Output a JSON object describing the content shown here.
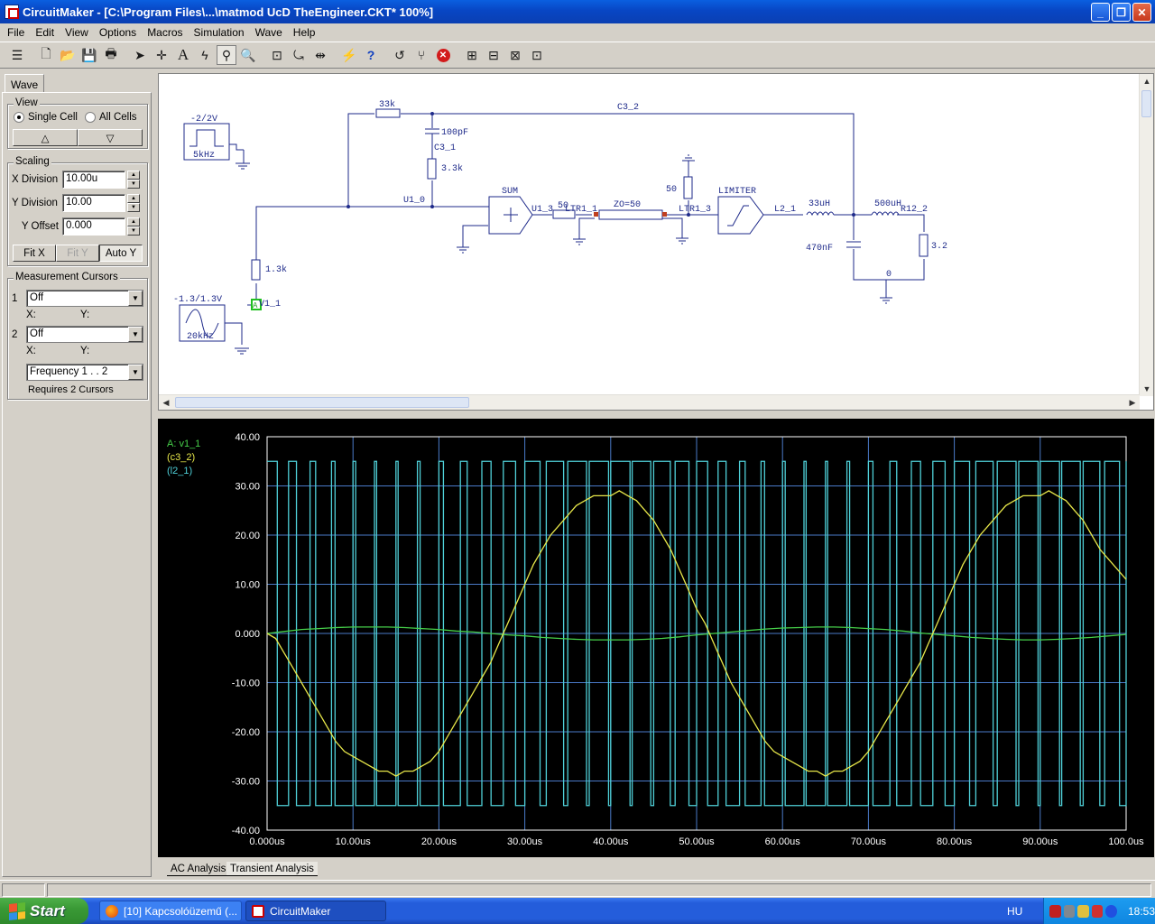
{
  "window": {
    "title": "CircuitMaker - [C:\\Program Files\\...\\matmod UcD TheEngineer.CKT* 100%]",
    "minimize_label": "_",
    "maximize_label": "❐",
    "close_label": "✕"
  },
  "menu": [
    "File",
    "Edit",
    "View",
    "Options",
    "Macros",
    "Simulation",
    "Wave",
    "Help"
  ],
  "panel": {
    "tab_label": "Wave",
    "view": {
      "title": "View",
      "single_cell": "Single Cell",
      "all_cells": "All Cells",
      "selected": "single",
      "up_glyph": "△",
      "down_glyph": "▽"
    },
    "scaling": {
      "title": "Scaling",
      "x_label": "X Division",
      "x_value": "10.00u",
      "y_label": "Y Division",
      "y_value": "10.00",
      "offset_label": "Y Offset",
      "offset_value": "0.000",
      "fitx": "Fit X",
      "fity": "Fit Y",
      "autoy": "Auto Y"
    },
    "cursors": {
      "title": "Measurement Cursors",
      "c1_num": "1",
      "c1_value": "Off",
      "c2_num": "2",
      "c2_value": "Off",
      "x_label": "X:",
      "y_label": "Y:",
      "freq_value": "Frequency  1 . . 2",
      "requires": "Requires 2 Cursors"
    }
  },
  "schematic": {
    "labels": {
      "sq_amp": "-2/2V",
      "sq_freq": "5kHz",
      "sin_amp": "-1.3/1.3V",
      "sin_freq": "20kHz",
      "r33k": "33k",
      "c100p": "100pF",
      "c3_1": "C3_1",
      "r3k3": "3.3k",
      "u1_0": "U1_0",
      "r1k3": "1.3k",
      "v1_1": "V1_1",
      "probe": "A",
      "sum": "SUM",
      "u1_3": "U1_3",
      "r50a": "50",
      "ltr1_1": "LTR1_1",
      "zo": "ZO=50",
      "ltr1_3": "LTR1_3",
      "r50b": "50",
      "limiter": "LIMITER",
      "l2_1": "L2_1",
      "l33u": "33uH",
      "l500u": "500uH",
      "r12_2": "R12_2",
      "c3_2": "C3_2",
      "c470n": "470nF",
      "r32": "3.2",
      "node0": "0"
    }
  },
  "chart_data": {
    "type": "line",
    "x_unit": "us",
    "xlim": [
      0,
      100
    ],
    "ylim": [
      -40,
      40
    ],
    "grid": true,
    "legend_position": "top-left",
    "x_tick_labels": [
      "0.000us",
      "10.00us",
      "20.00us",
      "30.00us",
      "40.00us",
      "50.00us",
      "60.00us",
      "70.00us",
      "80.00us",
      "90.00us",
      "100.0us"
    ],
    "y_tick_labels": [
      "40.00",
      "30.00",
      "20.00",
      "10.00",
      "0.000",
      "-10.00",
      "-20.00",
      "-30.00",
      "-40.00"
    ],
    "y_ticks": [
      40,
      30,
      20,
      10,
      0,
      -10,
      -20,
      -30,
      -40
    ],
    "axis_color": "#ffffff",
    "grid_color": "#4a7ac8",
    "series": [
      {
        "name": "A: v1_1",
        "color": "#46d04a",
        "x": [
          0,
          2,
          4,
          6,
          8,
          10,
          12,
          14,
          16,
          18,
          20,
          22,
          24,
          26,
          28,
          30,
          32,
          34,
          36,
          38,
          40,
          42,
          44,
          46,
          48,
          50,
          52,
          54,
          56,
          58,
          60,
          62,
          64,
          66,
          68,
          70,
          72,
          74,
          76,
          78,
          80,
          82,
          84,
          86,
          88,
          90,
          92,
          94,
          96,
          98,
          100
        ],
        "y": [
          0,
          0.4,
          0.8,
          1.0,
          1.2,
          1.3,
          1.3,
          1.3,
          1.2,
          1.0,
          0.8,
          0.5,
          0.3,
          0,
          -0.3,
          -0.5,
          -0.8,
          -1.0,
          -1.2,
          -1.3,
          -1.3,
          -1.3,
          -1.2,
          -1.0,
          -0.7,
          -0.3,
          0,
          0.3,
          0.6,
          0.9,
          1.1,
          1.2,
          1.3,
          1.3,
          1.2,
          1.0,
          0.8,
          0.5,
          0.1,
          -0.2,
          -0.5,
          -0.8,
          -1.0,
          -1.2,
          -1.3,
          -1.3,
          -1.2,
          -1.0,
          -0.8,
          -0.5,
          -0.2
        ]
      },
      {
        "name": "(c3_2)",
        "color": "#e8e84a",
        "x": [
          0,
          1,
          2,
          3,
          4,
          5,
          6,
          7,
          8,
          9,
          10,
          11,
          12,
          13,
          14,
          15,
          16,
          17,
          18,
          19,
          20,
          21,
          22,
          23,
          24,
          25,
          26,
          27,
          28,
          29,
          30,
          31,
          32,
          33,
          34,
          35,
          36,
          37,
          38,
          39,
          40,
          41,
          42,
          43,
          44,
          45,
          46,
          47,
          48,
          49,
          50,
          51,
          52,
          53,
          54,
          55,
          56,
          57,
          58,
          59,
          60,
          61,
          62,
          63,
          64,
          65,
          66,
          67,
          68,
          69,
          70,
          71,
          72,
          73,
          74,
          75,
          76,
          77,
          78,
          79,
          80,
          81,
          82,
          83,
          84,
          85,
          86,
          87,
          88,
          89,
          90,
          91,
          92,
          93,
          94,
          95,
          96,
          97,
          98,
          99,
          100
        ],
        "y": [
          0,
          -1,
          -4,
          -7,
          -10,
          -13,
          -16,
          -19,
          -22,
          -24,
          -25,
          -26,
          -27,
          -28,
          -28,
          -29,
          -28,
          -28,
          -27,
          -26,
          -24,
          -21,
          -18,
          -15,
          -12,
          -9,
          -6,
          -2,
          2,
          6,
          10,
          14,
          17,
          20,
          22,
          24,
          26,
          27,
          28,
          28,
          28,
          29,
          28,
          27,
          25,
          23,
          20,
          17,
          13,
          9,
          5,
          2,
          -2,
          -6,
          -10,
          -13,
          -16,
          -19,
          -22,
          -24,
          -25,
          -26,
          -27,
          -28,
          -28,
          -29,
          -28,
          -28,
          -27,
          -26,
          -24,
          -21,
          -18,
          -15,
          -12,
          -9,
          -6,
          -2,
          2,
          6,
          10,
          14,
          17,
          20,
          22,
          24,
          26,
          27,
          28,
          28,
          28,
          29,
          28,
          27,
          25,
          23,
          20,
          17,
          15,
          13,
          11
        ]
      },
      {
        "name": "(l2_1)",
        "color": "#4fd0d8",
        "kind": "pwm",
        "high": 35,
        "low": -35,
        "period_us": 2.5,
        "base_duty": 0.5
      }
    ]
  },
  "bottom_tabs": [
    "AC Analysis",
    "Transient Analysis"
  ],
  "taskbar": {
    "start_label": "Start",
    "tasks": [
      "[10] Kapcsolóüzemű (...",
      "CircuitMaker"
    ],
    "lang": "HU",
    "clock": "18:53"
  }
}
